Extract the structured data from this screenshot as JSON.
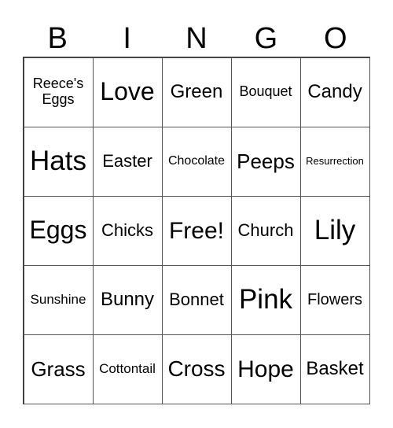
{
  "header": {
    "letters": [
      "B",
      "I",
      "N",
      "G",
      "O"
    ]
  },
  "card": {
    "rows": [
      [
        "Reece's Eggs",
        "Love",
        "Green",
        "Bouquet",
        "Candy"
      ],
      [
        "Hats",
        "Easter",
        "Chocolate",
        "Peeps",
        "Resurrection"
      ],
      [
        "Eggs",
        "Chicks",
        "Free!",
        "Church",
        "Lily"
      ],
      [
        "Sunshine",
        "Bunny",
        "Bonnet",
        "Pink",
        "Flowers"
      ],
      [
        "Grass",
        "Cottontail",
        "Cross",
        "Hope",
        "Basket"
      ]
    ]
  }
}
